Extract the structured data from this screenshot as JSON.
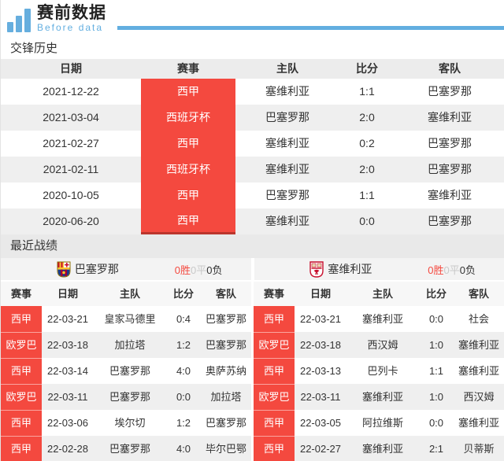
{
  "logo": {
    "title": "赛前数据",
    "subtitle": "Before data"
  },
  "sections": {
    "h2h_title": "交锋历史",
    "recent_title": "最近战绩"
  },
  "colors": {
    "accent_red": "#f4493f",
    "accent_blue": "#62aee0",
    "row_alt_gray": "#efefef",
    "win_red": "#f4493f",
    "draw_gray": "#c9c9c9",
    "loss_dark": "#333333"
  },
  "h2h": {
    "headers": [
      "日期",
      "赛事",
      "主队",
      "比分",
      "客队"
    ],
    "rows": [
      {
        "date": "2021-12-22",
        "comp": "西甲",
        "home": "塞维利亚",
        "score": "1:1",
        "away": "巴塞罗那"
      },
      {
        "date": "2021-03-04",
        "comp": "西班牙杯",
        "home": "巴塞罗那",
        "score": "2:0",
        "away": "塞维利亚"
      },
      {
        "date": "2021-02-27",
        "comp": "西甲",
        "home": "塞维利亚",
        "score": "0:2",
        "away": "巴塞罗那"
      },
      {
        "date": "2021-02-11",
        "comp": "西班牙杯",
        "home": "塞维利亚",
        "score": "2:0",
        "away": "巴塞罗那"
      },
      {
        "date": "2020-10-05",
        "comp": "西甲",
        "home": "巴塞罗那",
        "score": "1:1",
        "away": "塞维利亚"
      },
      {
        "date": "2020-06-20",
        "comp": "西甲",
        "home": "塞维利亚",
        "score": "0:0",
        "away": "巴塞罗那"
      }
    ]
  },
  "recent": {
    "left": {
      "team": "巴塞罗那",
      "record": {
        "wins": "0胜",
        "draws": "0平",
        "losses": "0负"
      },
      "headers": [
        "赛事",
        "日期",
        "主队",
        "比分",
        "客队"
      ],
      "rows": [
        {
          "comp": "西甲",
          "date": "22-03-21",
          "home": "皇家马德里",
          "score": "0:4",
          "away": "巴塞罗那"
        },
        {
          "comp": "欧罗巴",
          "date": "22-03-18",
          "home": "加拉塔",
          "score": "1:2",
          "away": "巴塞罗那"
        },
        {
          "comp": "西甲",
          "date": "22-03-14",
          "home": "巴塞罗那",
          "score": "4:0",
          "away": "奥萨苏纳"
        },
        {
          "comp": "欧罗巴",
          "date": "22-03-11",
          "home": "巴塞罗那",
          "score": "0:0",
          "away": "加拉塔"
        },
        {
          "comp": "西甲",
          "date": "22-03-06",
          "home": "埃尔切",
          "score": "1:2",
          "away": "巴塞罗那"
        },
        {
          "comp": "西甲",
          "date": "22-02-28",
          "home": "巴塞罗那",
          "score": "4:0",
          "away": "毕尔巴鄂"
        }
      ]
    },
    "right": {
      "team": "塞维利亚",
      "record": {
        "wins": "0胜",
        "draws": "0平",
        "losses": "0负"
      },
      "headers": [
        "赛事",
        "日期",
        "主队",
        "比分",
        "客队"
      ],
      "rows": [
        {
          "comp": "西甲",
          "date": "22-03-21",
          "home": "塞维利亚",
          "score": "0:0",
          "away": "社会"
        },
        {
          "comp": "欧罗巴",
          "date": "22-03-18",
          "home": "西汉姆",
          "score": "1:0",
          "away": "塞维利亚"
        },
        {
          "comp": "西甲",
          "date": "22-03-13",
          "home": "巴列卡",
          "score": "1:1",
          "away": "塞维利亚"
        },
        {
          "comp": "欧罗巴",
          "date": "22-03-11",
          "home": "塞维利亚",
          "score": "1:0",
          "away": "西汉姆"
        },
        {
          "comp": "西甲",
          "date": "22-03-05",
          "home": "阿拉维斯",
          "score": "0:0",
          "away": "塞维利亚"
        },
        {
          "comp": "西甲",
          "date": "22-02-27",
          "home": "塞维利亚",
          "score": "2:1",
          "away": "贝蒂斯"
        }
      ]
    }
  }
}
